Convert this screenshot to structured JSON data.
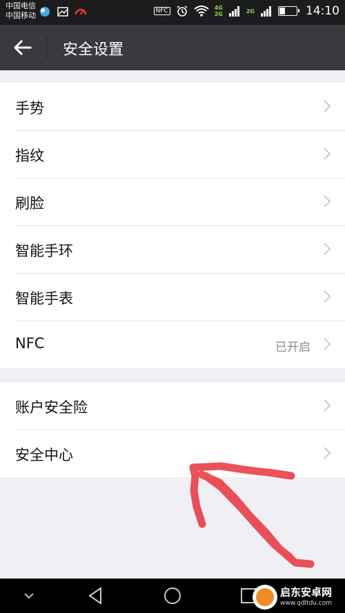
{
  "status_bar": {
    "carrier_1": "中国电信",
    "carrier_2": "中国移动",
    "nfc": "NFC",
    "net_4g": "4G",
    "net_2g_a": "2G",
    "net_2g_b": "2G",
    "time": "14:10",
    "battery_level": 0.3
  },
  "toolbar": {
    "title": "安全设置",
    "back_icon": "back-arrow"
  },
  "groups": [
    {
      "items": [
        {
          "label": "手势",
          "value": ""
        },
        {
          "label": "指纹",
          "value": ""
        },
        {
          "label": "刷脸",
          "value": ""
        },
        {
          "label": "智能手环",
          "value": ""
        },
        {
          "label": "智能手表",
          "value": ""
        },
        {
          "label": "NFC",
          "value": "已开启"
        }
      ]
    },
    {
      "items": [
        {
          "label": "账户安全险",
          "value": ""
        },
        {
          "label": "安全中心",
          "value": ""
        }
      ]
    }
  ],
  "nav_bar": {
    "icons": [
      "chevron-down",
      "back-triangle",
      "home-circle",
      "recents-square"
    ]
  },
  "watermark": {
    "name": "启东安卓网",
    "url": "www.qdltdu.com"
  },
  "colors": {
    "toolbar_bg": "#393a3f",
    "status_bg": "#1c1c1c",
    "page_bg": "#efeff4",
    "annotation": "#e8343f"
  }
}
